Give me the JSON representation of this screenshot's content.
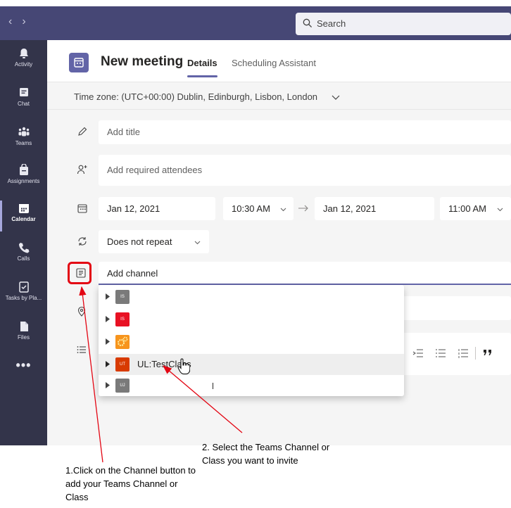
{
  "titlebar": {
    "nav_back": "‹",
    "nav_forward": "›",
    "search_placeholder": "Search"
  },
  "rail": {
    "items": [
      {
        "label": "Activity",
        "icon": "bell-icon"
      },
      {
        "label": "Chat",
        "icon": "chat-icon"
      },
      {
        "label": "Teams",
        "icon": "teams-icon"
      },
      {
        "label": "Assignments",
        "icon": "assignments-icon"
      },
      {
        "label": "Calendar",
        "icon": "calendar-icon",
        "active": true
      },
      {
        "label": "Calls",
        "icon": "phone-icon"
      },
      {
        "label": "Tasks by Pla...",
        "icon": "tasks-icon"
      },
      {
        "label": "Files",
        "icon": "files-icon"
      }
    ],
    "more": "•••"
  },
  "header": {
    "title": "New meeting",
    "tabs": [
      {
        "label": "Details",
        "active": true
      },
      {
        "label": "Scheduling Assistant"
      }
    ]
  },
  "timezone": {
    "label": "Time zone: (UTC+00:00) Dublin, Edinburgh, Lisbon, London"
  },
  "form": {
    "title_placeholder": "Add title",
    "attendees_placeholder": "Add required attendees",
    "start_date": "Jan 12, 2021",
    "start_time": "10:30 AM",
    "end_date": "Jan 12, 2021",
    "end_time": "11:00 AM",
    "repeat": "Does not repeat",
    "channel_placeholder": "Add channel"
  },
  "dropdown": {
    "items": [
      {
        "avatar_text": "IS",
        "avatar_color": "#7a7a7a",
        "label": ""
      },
      {
        "avatar_text": "IS",
        "avatar_color": "#e81123",
        "label": ""
      },
      {
        "avatar_text": "",
        "avatar_color": "#f7941d",
        "label": "",
        "icon": "gears-icon"
      },
      {
        "avatar_text": "UT",
        "avatar_color": "#d83b01",
        "label": "UL:TestClass",
        "hovered": true
      },
      {
        "avatar_text": "UJ",
        "avatar_color": "#7a7a7a",
        "label": ""
      }
    ]
  },
  "annotations": {
    "step1": "1.Click on the Channel button to add your Teams Channel or Class",
    "step2": "2. Select the Teams Channel or Class you want to invite"
  },
  "colors": {
    "titlebar": "#464775",
    "rail": "#33344a",
    "accent": "#6264a7",
    "annotation": "#e30613"
  }
}
